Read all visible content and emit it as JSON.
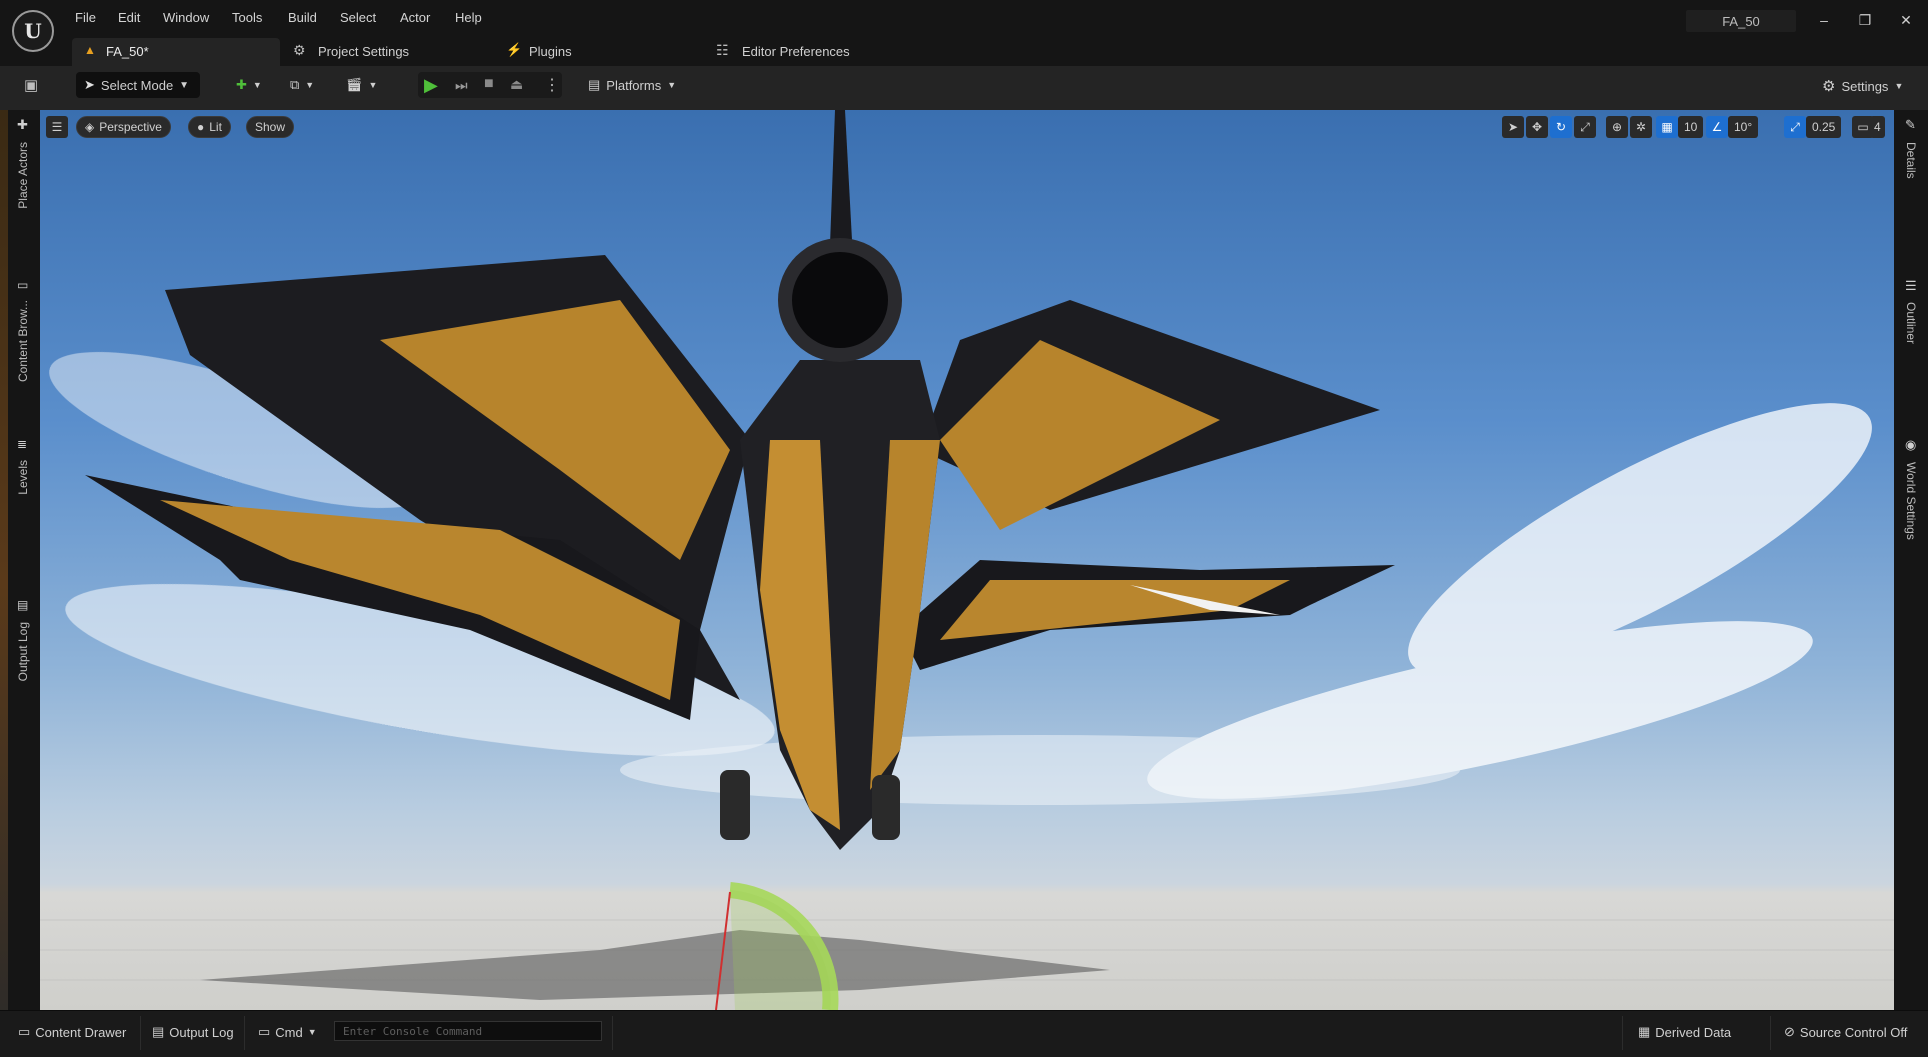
{
  "menu": [
    "File",
    "Edit",
    "Window",
    "Tools",
    "Build",
    "Select",
    "Actor",
    "Help"
  ],
  "window": {
    "project_name": "FA_50",
    "minimize": "–",
    "restore": "❐",
    "close": "✕"
  },
  "tabs": [
    {
      "label": "FA_50*"
    },
    {
      "label": "Project Settings"
    },
    {
      "label": "Plugins"
    },
    {
      "label": "Editor Preferences"
    }
  ],
  "toolbar": {
    "select_mode": "Select Mode",
    "platforms": "Platforms",
    "settings": "Settings"
  },
  "left_panel": [
    "Place Actors",
    "Content Brow...",
    "Levels",
    "Output Log"
  ],
  "right_panel": [
    "Details",
    "Outliner",
    "World Settings"
  ],
  "viewport": {
    "view_mode": "Perspective",
    "lighting": "Lit",
    "show": "Show",
    "grid_snap": "10",
    "rotation_snap": "10°",
    "scale_snap": "0.25",
    "camera_speed": "4"
  },
  "status": {
    "content_drawer": "Content Drawer",
    "output_log": "Output Log",
    "cmd": "Cmd",
    "console_placeholder": "Enter Console Command",
    "derived_data": "Derived Data",
    "source_control": "Source Control Off"
  },
  "colors": {
    "accent_blue": "#1e6fd0",
    "play_green": "#4fbf3a",
    "warning_orange": "#e8a020"
  }
}
